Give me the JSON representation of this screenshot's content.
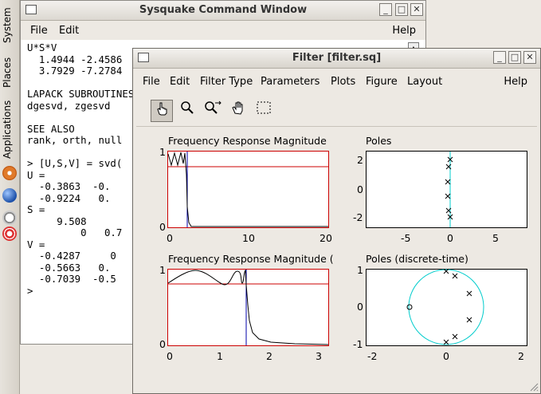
{
  "panel": {
    "labels": [
      "System",
      "Places",
      "Applications"
    ]
  },
  "cmd": {
    "title": "Sysquake Command Window",
    "menu": {
      "file": "File",
      "edit": "Edit",
      "help": "Help"
    },
    "lines": [
      "U*S*V",
      "  1.4944 -2.4586",
      "  3.7929 -7.2784",
      "",
      "LAPACK SUBROUTINES",
      "dgesvd, zgesvd",
      "",
      "SEE ALSO",
      "rank, orth, null",
      "",
      "> [U,S,V] = svd(",
      "U =",
      "  -0.3863  -0.",
      "  -0.9224   0.",
      "S =",
      "     9.508",
      "         0   0.7",
      "V =",
      "  -0.4287     0",
      "  -0.5663   0.",
      "  -0.7039  -0.5",
      ">"
    ]
  },
  "filter": {
    "title": "Filter [filter.sq]",
    "menu": [
      "File",
      "Edit",
      "Filter Type",
      "Parameters",
      "Plots",
      "Figure",
      "Layout",
      "Help"
    ],
    "tools": [
      "hand-pointer-icon",
      "zoom-icon",
      "zoom-x-icon",
      "pan-hand-icon",
      "select-rect-icon"
    ],
    "plots": {
      "p1": {
        "title": "Frequency Response Magnitude",
        "xticks": [
          "0",
          "10",
          "20"
        ],
        "yticks": [
          "1",
          "0"
        ]
      },
      "p2": {
        "title": "Poles",
        "xticks": [
          "-5",
          "0",
          "5"
        ],
        "yticks": [
          "2",
          "0",
          "-2"
        ]
      },
      "p3": {
        "title": "Frequency Response Magnitude (",
        "xticks": [
          "0",
          "1",
          "2",
          "3"
        ],
        "yticks": [
          "1",
          "0"
        ]
      },
      "p4": {
        "title": "Poles (discrete-time)",
        "xticks": [
          "-2",
          "0",
          "2"
        ],
        "yticks": [
          "1",
          "0",
          "-1"
        ]
      }
    },
    "colors": {
      "trace": "#000000",
      "cutoff": "#0000aa",
      "limit": "#cc0000",
      "axis": "#00cccc",
      "frame": "#cc0000"
    }
  }
}
